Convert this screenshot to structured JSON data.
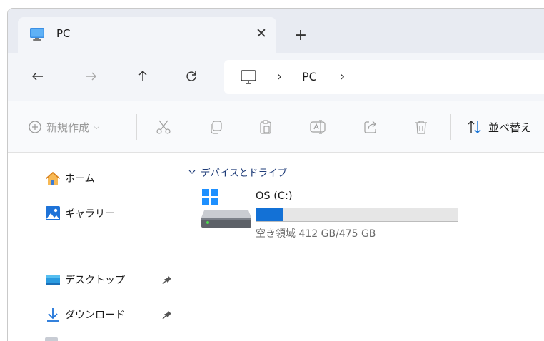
{
  "tab": {
    "title": "PC",
    "close_glyph": "✕",
    "new_tab_glyph": "+"
  },
  "nav": {
    "back_icon": "arrow-left-icon",
    "forward_icon": "arrow-right-icon",
    "up_icon": "arrow-up-icon",
    "refresh_icon": "refresh-icon",
    "breadcrumb": {
      "sep": "›",
      "location": "PC"
    }
  },
  "toolbar": {
    "new_label": "新規作成",
    "new_chevron": "⌵",
    "sort_label": "並べ替え",
    "icons": [
      "cut-icon",
      "copy-icon",
      "paste-icon",
      "rename-icon",
      "share-icon",
      "delete-icon"
    ]
  },
  "sidebar": {
    "items": [
      {
        "label": "ホーム",
        "icon": "home-icon"
      },
      {
        "label": "ギャラリー",
        "icon": "gallery-icon"
      },
      {
        "label": "デスクトップ",
        "icon": "desktop-folder-icon",
        "pinned": true
      },
      {
        "label": "ダウンロード",
        "icon": "download-icon",
        "pinned": true
      }
    ]
  },
  "main": {
    "group_title": "デバイスとドライブ",
    "drives": [
      {
        "name": "OS (C:)",
        "free_text": "空き領域 412 GB/475 GB",
        "used_fraction": 0.133
      }
    ]
  },
  "colors": {
    "accent": "#1371d6",
    "tab_strip": "#e8ebf2",
    "toolbar_bg": "#f9fafc",
    "group_header": "#1f3c78"
  }
}
